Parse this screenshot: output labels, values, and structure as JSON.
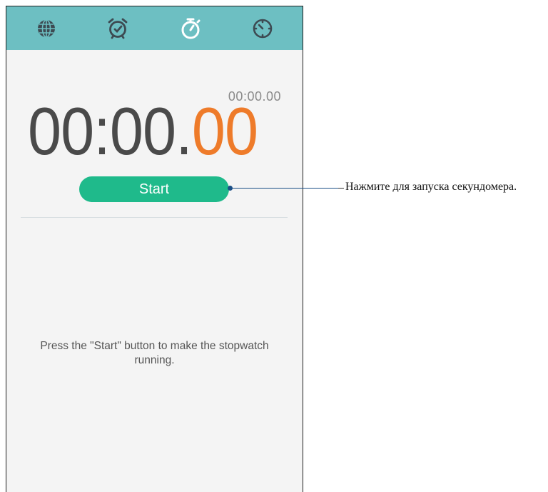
{
  "tabs": [
    {
      "name": "world-clock",
      "icon": "globe-icon"
    },
    {
      "name": "alarm",
      "icon": "alarm-clock-icon"
    },
    {
      "name": "stopwatch",
      "icon": "stopwatch-icon",
      "active": true
    },
    {
      "name": "timer",
      "icon": "timer-icon"
    }
  ],
  "stopwatch": {
    "lap_time": "00:00.00",
    "time_main": "00:00.",
    "time_hundredths": "00",
    "start_label": "Start",
    "hint": "Press the \"Start\" button to make the stopwatch running."
  },
  "annotation": {
    "text": "Нажмите для запуска секундомера."
  },
  "colors": {
    "tabbar": "#6dbfc2",
    "start_button": "#1fba8b",
    "hundredths": "#ee7b2a",
    "callout_line": "#1b4f86"
  }
}
